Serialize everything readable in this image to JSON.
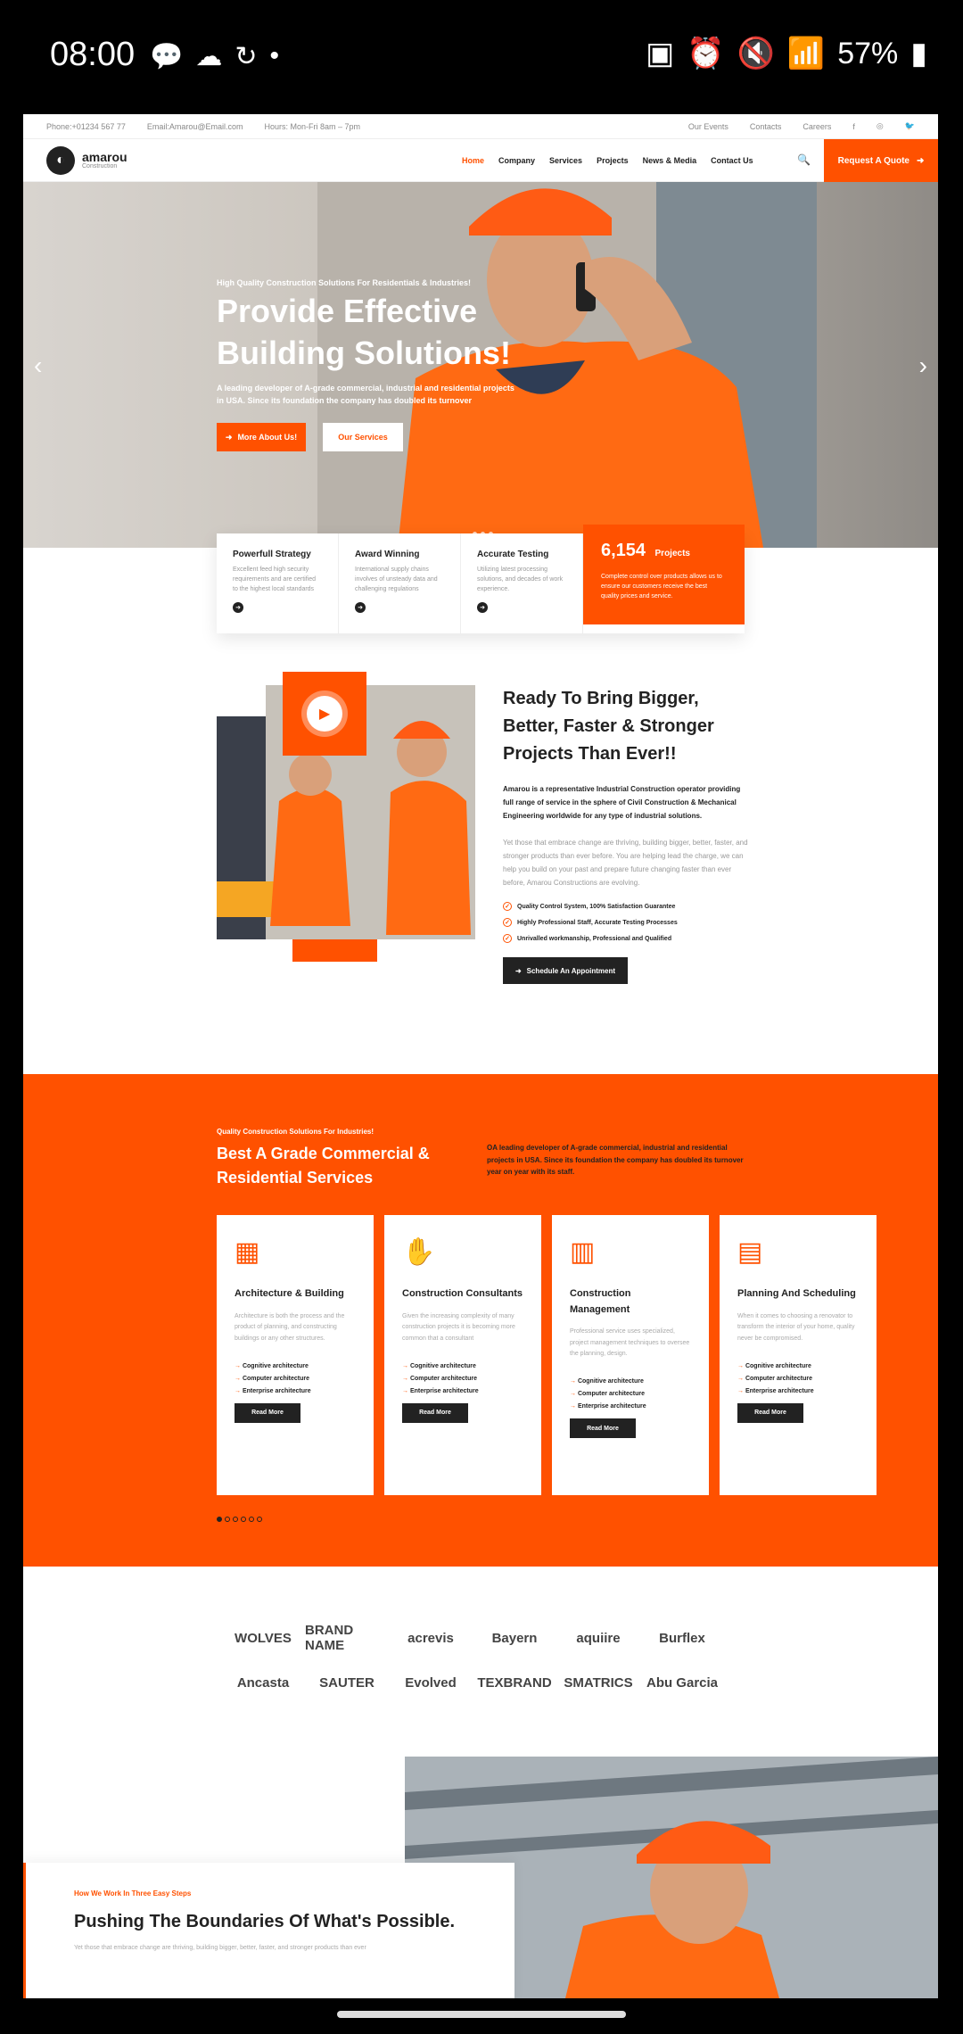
{
  "status_bar": {
    "time": "08:00",
    "battery": "57%"
  },
  "topbar": {
    "phone": "Phone:+01234 567 77",
    "email": "Email:Amarou@Email.com",
    "hours": "Hours: Mon-Fri 8am – 7pm",
    "links": [
      "Our Events",
      "Contacts",
      "Careers"
    ]
  },
  "header": {
    "logo_name": "amarou",
    "logo_sub": "Construction",
    "nav": [
      "Home",
      "Company",
      "Services",
      "Projects",
      "News & Media",
      "Contact Us"
    ],
    "quote_button": "Request A Quote"
  },
  "hero": {
    "kicker": "High Quality Construction Solutions For Residentials & Industries!",
    "title": "Provide Effective Building Solutions!",
    "description": "A leading developer of A-grade commercial, industrial and residential projects in USA. Since its foundation the company has doubled its turnover",
    "button_primary": "More About Us!",
    "button_secondary": "Our Services"
  },
  "features": [
    {
      "title": "Powerfull Strategy",
      "desc": "Excellent feed high security requirements and are certified to the highest local standards"
    },
    {
      "title": "Award Winning",
      "desc": "International supply chains involves of unsteady data and challenging regulations"
    },
    {
      "title": "Accurate Testing",
      "desc": "Utilizing latest processing solutions, and decades of work experience."
    }
  ],
  "projects": {
    "count": "6,154",
    "label": "Projects",
    "desc": "Complete control over products allows us to ensure our customers receive the best quality prices and service."
  },
  "about": {
    "title": "Ready To Bring Bigger, Better, Faster & Stronger Projects Than Ever!!",
    "lead": "Amarou is a representative Industrial Construction operator providing full range of service in the sphere of Civil Construction & Mechanical Engineering worldwide for any type of industrial solutions.",
    "body": "Yet those that embrace change are thriving, building bigger, better, faster, and stronger products than ever before. You are helping lead the charge, we can help you build on your past and prepare future changing faster than ever before, Amarou Constructions are evolving.",
    "checks": [
      "Quality Control System, 100% Satisfaction Guarantee",
      "Highly Professional Staff, Accurate Testing Processes",
      "Unrivalled workmanship, Professional and Qualified"
    ],
    "button": "Schedule An Appointment"
  },
  "services": {
    "kicker": "Quality Construction Solutions For Industries!",
    "title": "Best A Grade Commercial & Residential Services",
    "intro": "OA leading developer of A-grade commercial, industrial and residential projects in USA. Since its foundation the company has doubled its turnover year on year with its staff.",
    "cards": [
      {
        "title": "Architecture & Building",
        "desc": "Architecture is both the process and the product of planning, and constructing buildings or any other structures.",
        "items": [
          "Cognitive architecture",
          "Computer architecture",
          "Enterprise architecture"
        ],
        "button": "Read More",
        "icon": "brick-wall-icon"
      },
      {
        "title": "Construction Consultants",
        "desc": "Given the increasing complexity of many construction projects it is becoming more common that a consultant",
        "items": [
          "Cognitive architecture",
          "Computer architecture",
          "Enterprise architecture"
        ],
        "button": "Read More",
        "icon": "gloves-icon"
      },
      {
        "title": "Construction Management",
        "desc": "Professional service uses specialized, project management techniques to oversee the planning, design.",
        "items": [
          "Cognitive architecture",
          "Computer architecture",
          "Enterprise architecture"
        ],
        "button": "Read More",
        "icon": "safety-vest-icon"
      },
      {
        "title": "Planning And Scheduling",
        "desc": "When it comes to choosing a renovator to transform the interior of your home, quality never be compromised.",
        "items": [
          "Cognitive architecture",
          "Computer architecture",
          "Enterprise architecture"
        ],
        "button": "Read More",
        "icon": "blueprint-icon"
      }
    ]
  },
  "brands": [
    "WOLVES",
    "BRAND NAME",
    "acrevis",
    "Bayern",
    "aquiire",
    "Burflex",
    "Ancasta",
    "SAUTER",
    "Evolved",
    "TEXBRAND",
    "SMATRICS",
    "Abu Garcia"
  ],
  "steps": {
    "kicker": "How We Work In Three Easy Steps",
    "title": "Pushing The Boundaries Of What's Possible.",
    "body": "Yet those that embrace change are thriving, building bigger, better, faster, and stronger products than ever"
  },
  "colors": {
    "accent": "#ff5100",
    "dark": "#222222"
  }
}
